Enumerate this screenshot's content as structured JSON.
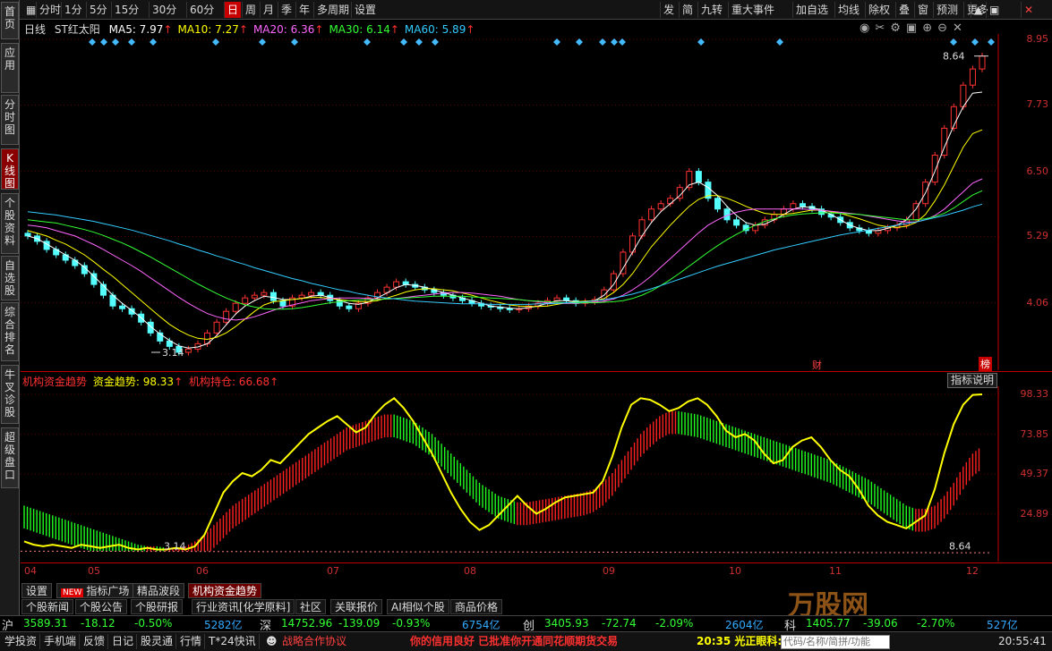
{
  "toolbar": {
    "items": [
      "分时",
      "1分",
      "5分",
      "15分",
      "30分",
      "60分",
      "日",
      "周",
      "月",
      "季",
      "年",
      "多周期",
      "设置"
    ],
    "active": 6,
    "right": [
      "发",
      "简",
      "九转",
      "重大事件",
      "加自选",
      "均线",
      "除权",
      "叠",
      "窗",
      "预测",
      "更多"
    ]
  },
  "left_tabs": [
    "首页",
    "应用",
    "分时图",
    "K线图",
    "个股资料",
    "自选股",
    "综合排名",
    "牛叉诊股",
    "超级盘口"
  ],
  "left_active": 3,
  "main": {
    "period": "日线",
    "stock": "ST红太阳",
    "ma": [
      {
        "label": "MA5: 7.97",
        "color": "#ffffff"
      },
      {
        "label": "MA10: 7.27",
        "color": "#ffff00"
      },
      {
        "label": "MA20: 6.36",
        "color": "#ff66ff"
      },
      {
        "label": "MA30: 6.14",
        "color": "#33ff33"
      },
      {
        "label": "MA60: 5.89",
        "color": "#33ccff"
      }
    ],
    "arrow": "↑",
    "yticks": [
      "8.95",
      "7.73",
      "6.50",
      "5.29",
      "4.06"
    ],
    "high_label": "8.64",
    "low_label": "3.14",
    "cai": "财",
    "bang": "榜"
  },
  "indicator": {
    "name": "机构资金趋势",
    "l1": "资金趋势: 98.33",
    "l2": "机构持仓: 66.68",
    "arrow": "↑",
    "help": "指标说明",
    "yticks": [
      "98.33",
      "73.85",
      "49.37",
      "24.89"
    ],
    "lbl_low": "3.14",
    "lbl_high": "8.64"
  },
  "xaxis": [
    "04",
    "05",
    "06",
    "07",
    "08",
    "09",
    "10",
    "11",
    "12"
  ],
  "panel_tabs": [
    "设置",
    "指标广场",
    "精品波段",
    "机构资金趋势"
  ],
  "new_badge": "NEW",
  "panel_active": 3,
  "news_tabs": [
    "个股新闻",
    "个股公告",
    "个股研报",
    "行业资讯[化学原料]",
    "社区",
    "关联报价",
    "AI相似个股",
    "商品价格"
  ],
  "index_bar": [
    {
      "name": "沪",
      "price": "3589.31",
      "chg": "-18.12",
      "pct": "-0.50%",
      "amt": "5282亿"
    },
    {
      "name": "深",
      "price": "14752.96",
      "chg": "-139.09",
      "pct": "-0.93%",
      "amt": "6754亿"
    },
    {
      "name": "创",
      "price": "3405.93",
      "chg": "-72.74",
      "pct": "-2.09%",
      "amt": "2604亿"
    },
    {
      "name": "科",
      "price": "1405.77",
      "chg": "-39.06",
      "pct": "-2.70%",
      "amt": "527亿"
    }
  ],
  "bottom": {
    "items": [
      "学投资",
      "手机端",
      "反馈",
      "日记",
      "股灵通",
      "行情",
      "T*24快讯"
    ],
    "promo": "战略合作协议",
    "ticker": "你的信用良好 已批准你开通同花顺期货交易",
    "time_msg": "20:35 光正眼科:",
    "search": "代码/名称/简拼/功能",
    "clock": "20:55:41"
  },
  "watermark": "万股网",
  "chart_data": {
    "type": "candlestick",
    "x_ticks": [
      "04",
      "05",
      "06",
      "07",
      "08",
      "09",
      "10",
      "11",
      "12"
    ],
    "y_ticks": [
      8.95,
      7.73,
      6.5,
      5.29,
      4.06
    ],
    "ylim": [
      3.14,
      8.95
    ],
    "close": [
      5.3,
      5.2,
      5.05,
      4.95,
      4.85,
      4.75,
      4.6,
      4.4,
      4.2,
      4.0,
      3.95,
      3.85,
      3.7,
      3.5,
      3.35,
      3.25,
      3.14,
      3.2,
      3.3,
      3.5,
      3.7,
      3.9,
      4.05,
      4.15,
      4.2,
      4.25,
      4.1,
      4.0,
      4.15,
      4.2,
      4.25,
      4.2,
      4.1,
      4.0,
      3.95,
      4.05,
      4.15,
      4.25,
      4.35,
      4.45,
      4.4,
      4.35,
      4.3,
      4.25,
      4.2,
      4.15,
      4.1,
      4.05,
      4.0,
      3.98,
      3.95,
      3.93,
      3.95,
      4.0,
      4.05,
      4.1,
      4.15,
      4.1,
      4.05,
      4.08,
      4.12,
      4.3,
      4.6,
      5.0,
      5.3,
      5.6,
      5.8,
      5.9,
      6.0,
      6.2,
      6.5,
      6.3,
      6.0,
      5.8,
      5.6,
      5.5,
      5.4,
      5.5,
      5.6,
      5.7,
      5.8,
      5.9,
      5.85,
      5.8,
      5.7,
      5.65,
      5.55,
      5.45,
      5.4,
      5.35,
      5.4,
      5.45,
      5.5,
      5.6,
      5.9,
      6.3,
      6.8,
      7.3,
      7.7,
      8.1,
      8.4,
      8.64
    ],
    "series": [
      {
        "name": "MA5",
        "values": [
          5.3,
          5.25,
          5.15,
          5.05,
          4.95,
          4.85,
          4.72,
          4.55,
          4.38,
          4.2,
          4.05,
          3.92,
          3.78,
          3.62,
          3.48,
          3.36,
          3.26,
          3.22,
          3.24,
          3.3,
          3.45,
          3.65,
          3.85,
          4.0,
          4.1,
          4.18,
          4.16,
          4.12,
          4.12,
          4.14,
          4.18,
          4.2,
          4.16,
          4.1,
          4.05,
          4.03,
          4.07,
          4.15,
          4.24,
          4.34,
          4.4,
          4.38,
          4.35,
          4.3,
          4.25,
          4.2,
          4.15,
          4.1,
          4.05,
          4.0,
          3.98,
          3.96,
          3.95,
          3.97,
          4.0,
          4.05,
          4.1,
          4.1,
          4.08,
          4.08,
          4.1,
          4.2,
          4.4,
          4.7,
          5.0,
          5.3,
          5.55,
          5.75,
          5.9,
          6.05,
          6.25,
          6.3,
          6.2,
          6.05,
          5.85,
          5.68,
          5.55,
          5.5,
          5.52,
          5.6,
          5.7,
          5.8,
          5.84,
          5.83,
          5.78,
          5.7,
          5.6,
          5.5,
          5.44,
          5.4,
          5.4,
          5.44,
          5.5,
          5.6,
          5.8,
          6.1,
          6.5,
          6.95,
          7.35,
          7.7,
          7.95,
          7.97
        ]
      },
      {
        "name": "MA10",
        "values": [
          5.4,
          5.35,
          5.3,
          5.22,
          5.15,
          5.05,
          4.95,
          4.82,
          4.68,
          4.55,
          4.4,
          4.25,
          4.1,
          3.95,
          3.8,
          3.66,
          3.55,
          3.46,
          3.4,
          3.38,
          3.42,
          3.5,
          3.62,
          3.76,
          3.9,
          4.02,
          4.08,
          4.1,
          4.12,
          4.14,
          4.16,
          4.16,
          4.14,
          4.12,
          4.1,
          4.08,
          4.08,
          4.1,
          4.15,
          4.2,
          4.26,
          4.3,
          4.32,
          4.32,
          4.3,
          4.28,
          4.24,
          4.2,
          4.15,
          4.1,
          4.06,
          4.02,
          4.0,
          3.99,
          3.99,
          4.0,
          4.03,
          4.06,
          4.08,
          4.09,
          4.1,
          4.14,
          4.25,
          4.4,
          4.6,
          4.85,
          5.1,
          5.3,
          5.5,
          5.68,
          5.85,
          5.98,
          6.05,
          6.05,
          6.0,
          5.93,
          5.85,
          5.78,
          5.72,
          5.7,
          5.7,
          5.72,
          5.75,
          5.78,
          5.78,
          5.75,
          5.72,
          5.67,
          5.62,
          5.56,
          5.5,
          5.47,
          5.46,
          5.48,
          5.55,
          5.7,
          5.95,
          6.25,
          6.6,
          6.95,
          7.2,
          7.27
        ]
      },
      {
        "name": "MA20",
        "values": [
          5.5,
          5.48,
          5.45,
          5.4,
          5.35,
          5.3,
          5.22,
          5.14,
          5.05,
          4.95,
          4.85,
          4.75,
          4.64,
          4.52,
          4.4,
          4.28,
          4.16,
          4.05,
          3.95,
          3.86,
          3.8,
          3.76,
          3.74,
          3.76,
          3.8,
          3.86,
          3.92,
          3.98,
          4.02,
          4.06,
          4.1,
          4.12,
          4.14,
          4.15,
          4.15,
          4.15,
          4.14,
          4.13,
          4.13,
          4.14,
          4.16,
          4.18,
          4.2,
          4.22,
          4.24,
          4.25,
          4.25,
          4.24,
          4.22,
          4.2,
          4.18,
          4.15,
          4.12,
          4.1,
          4.08,
          4.06,
          4.05,
          4.05,
          4.05,
          4.06,
          4.07,
          4.09,
          4.13,
          4.2,
          4.3,
          4.42,
          4.56,
          4.72,
          4.88,
          5.04,
          5.2,
          5.36,
          5.5,
          5.6,
          5.68,
          5.74,
          5.78,
          5.8,
          5.8,
          5.8,
          5.8,
          5.8,
          5.8,
          5.79,
          5.78,
          5.76,
          5.74,
          5.72,
          5.7,
          5.67,
          5.64,
          5.61,
          5.58,
          5.56,
          5.56,
          5.6,
          5.68,
          5.8,
          5.96,
          6.12,
          6.28,
          6.36
        ]
      },
      {
        "name": "MA30",
        "values": [
          5.6,
          5.58,
          5.56,
          5.54,
          5.5,
          5.46,
          5.42,
          5.37,
          5.31,
          5.24,
          5.17,
          5.09,
          5.0,
          4.91,
          4.81,
          4.71,
          4.61,
          4.51,
          4.41,
          4.32,
          4.23,
          4.15,
          4.08,
          4.02,
          3.98,
          3.95,
          3.94,
          3.94,
          3.95,
          3.97,
          4.0,
          4.03,
          4.06,
          4.08,
          4.1,
          4.11,
          4.12,
          4.12,
          4.13,
          4.14,
          4.15,
          4.16,
          4.17,
          4.18,
          4.18,
          4.18,
          4.18,
          4.17,
          4.16,
          4.15,
          4.14,
          4.13,
          4.12,
          4.1,
          4.09,
          4.08,
          4.07,
          4.06,
          4.06,
          4.06,
          4.06,
          4.07,
          4.08,
          4.1,
          4.14,
          4.2,
          4.28,
          4.38,
          4.49,
          4.61,
          4.74,
          4.87,
          5.0,
          5.12,
          5.23,
          5.33,
          5.42,
          5.5,
          5.57,
          5.62,
          5.66,
          5.69,
          5.71,
          5.72,
          5.73,
          5.73,
          5.72,
          5.71,
          5.7,
          5.68,
          5.66,
          5.64,
          5.62,
          5.6,
          5.6,
          5.62,
          5.66,
          5.72,
          5.82,
          5.94,
          6.06,
          6.14
        ]
      },
      {
        "name": "MA60",
        "values": [
          5.75,
          5.73,
          5.71,
          5.69,
          5.66,
          5.63,
          5.6,
          5.57,
          5.53,
          5.49,
          5.45,
          5.41,
          5.36,
          5.31,
          5.26,
          5.21,
          5.15,
          5.1,
          5.04,
          4.99,
          4.93,
          4.88,
          4.82,
          4.77,
          4.71,
          4.66,
          4.61,
          4.56,
          4.51,
          4.47,
          4.42,
          4.38,
          4.34,
          4.3,
          4.27,
          4.23,
          4.2,
          4.17,
          4.15,
          4.13,
          4.11,
          4.09,
          4.08,
          4.07,
          4.06,
          4.05,
          4.04,
          4.04,
          4.04,
          4.03,
          4.03,
          4.03,
          4.03,
          4.03,
          4.04,
          4.04,
          4.05,
          4.06,
          4.07,
          4.08,
          4.1,
          4.12,
          4.15,
          4.18,
          4.22,
          4.27,
          4.32,
          4.38,
          4.44,
          4.5,
          4.56,
          4.62,
          4.68,
          4.74,
          4.79,
          4.84,
          4.89,
          4.94,
          4.99,
          5.04,
          5.08,
          5.12,
          5.16,
          5.2,
          5.24,
          5.28,
          5.32,
          5.35,
          5.38,
          5.41,
          5.44,
          5.47,
          5.5,
          5.53,
          5.56,
          5.6,
          5.64,
          5.68,
          5.73,
          5.78,
          5.84,
          5.89
        ]
      }
    ],
    "indicator": {
      "ylim": [
        0,
        100
      ],
      "y_ticks": [
        98.33,
        73.85,
        49.37,
        24.89
      ],
      "trend": [
        8,
        6,
        5,
        6,
        5,
        4,
        6,
        5,
        4,
        5,
        6,
        4,
        3,
        4,
        3,
        3,
        4,
        3,
        5,
        12,
        25,
        38,
        45,
        50,
        48,
        52,
        58,
        56,
        62,
        68,
        74,
        78,
        82,
        85,
        80,
        75,
        78,
        86,
        92,
        96,
        90,
        82,
        72,
        62,
        50,
        38,
        28,
        20,
        15,
        18,
        24,
        30,
        36,
        30,
        25,
        28,
        32,
        35,
        36,
        37,
        38,
        45,
        60,
        78,
        92,
        96,
        95,
        92,
        88,
        90,
        94,
        96,
        92,
        85,
        76,
        72,
        74,
        70,
        62,
        56,
        58,
        66,
        70,
        72,
        66,
        58,
        52,
        48,
        40,
        30,
        24,
        20,
        18,
        16,
        20,
        24,
        40,
        62,
        80,
        92,
        98,
        98.33
      ],
      "holding": [
        30,
        28,
        26,
        24,
        22,
        20,
        18,
        16,
        14,
        12,
        10,
        8,
        6,
        5,
        5,
        4,
        4,
        5,
        8,
        12,
        18,
        24,
        30,
        34,
        38,
        42,
        46,
        50,
        54,
        58,
        62,
        66,
        70,
        74,
        78,
        80,
        82,
        84,
        86,
        86,
        84,
        82,
        78,
        74,
        68,
        62,
        56,
        50,
        44,
        40,
        36,
        34,
        32,
        32,
        33,
        34,
        35,
        36,
        37,
        38,
        40,
        44,
        50,
        58,
        66,
        74,
        80,
        85,
        88,
        88,
        87,
        86,
        84,
        82,
        80,
        78,
        76,
        74,
        72,
        70,
        68,
        66,
        64,
        62,
        60,
        58,
        55,
        52,
        49,
        46,
        42,
        38,
        34,
        30,
        28,
        28,
        30,
        36,
        44,
        54,
        62,
        66.68
      ]
    }
  }
}
